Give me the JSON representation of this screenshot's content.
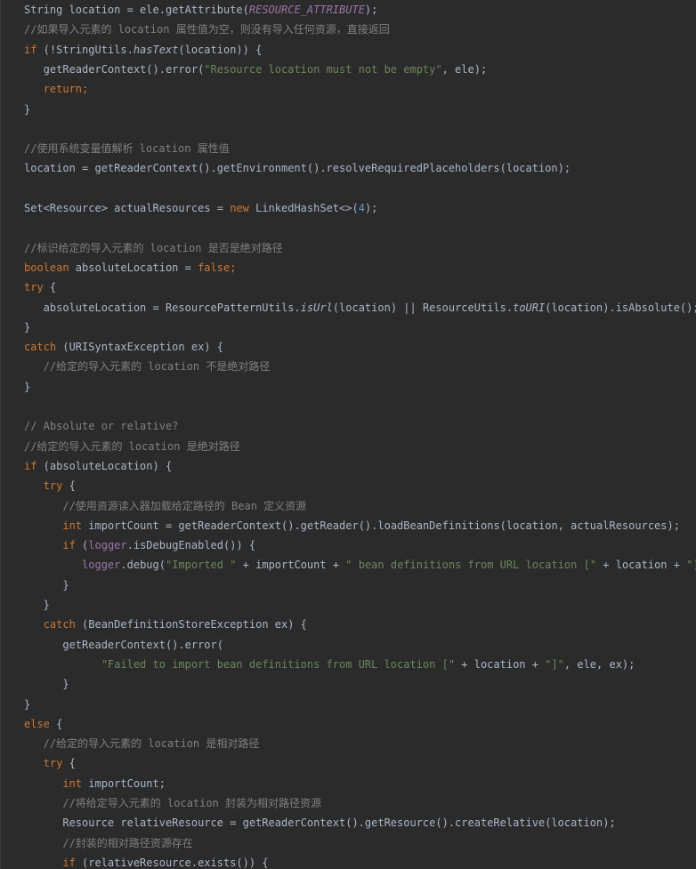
{
  "lines": [
    [
      {
        "t": "String location = ele.getAttribute(",
        "c": "pl"
      },
      {
        "t": "RESOURCE_ATTRIBUTE",
        "c": "cn"
      },
      {
        "t": ");",
        "c": "pl"
      }
    ],
    [
      {
        "t": "//如果导入元素的 location 属性值为空，则没有导入任何资源，直接返回",
        "c": "cm"
      }
    ],
    [
      {
        "t": "if",
        "c": "kw"
      },
      {
        "t": " (!StringUtils.",
        "c": "pl"
      },
      {
        "t": "hasText",
        "c": "it"
      },
      {
        "t": "(location)) {",
        "c": "pl"
      }
    ],
    [
      {
        "t": "   getReaderContext().error(",
        "c": "pl"
      },
      {
        "t": "\"Resource location must not be empty\"",
        "c": "str"
      },
      {
        "t": ", ele);",
        "c": "pl"
      }
    ],
    [
      {
        "t": "   ",
        "c": "pl"
      },
      {
        "t": "return",
        "c": "kw"
      },
      {
        "t": ";",
        "c": "kw"
      }
    ],
    [
      {
        "t": "}",
        "c": "pl"
      }
    ],
    [],
    [
      {
        "t": "//使用系统变量值解析 location 属性值",
        "c": "cm"
      }
    ],
    [
      {
        "t": "location = getReaderContext().getEnvironment().resolveRequiredPlaceholders(location);",
        "c": "pl"
      }
    ],
    [],
    [
      {
        "t": "Set<Resource> actualResources = ",
        "c": "pl"
      },
      {
        "t": "new",
        "c": "kw"
      },
      {
        "t": " LinkedHashSet<>(",
        "c": "pl"
      },
      {
        "t": "4",
        "c": "num"
      },
      {
        "t": ");",
        "c": "pl"
      }
    ],
    [],
    [
      {
        "t": "//标识给定的导入元素的 location 是否是绝对路径",
        "c": "cm"
      }
    ],
    [
      {
        "t": "boolean",
        "c": "kw"
      },
      {
        "t": " absoluteLocation = ",
        "c": "pl"
      },
      {
        "t": "false",
        "c": "kw"
      },
      {
        "t": ";",
        "c": "kw"
      }
    ],
    [
      {
        "t": "try",
        "c": "kw"
      },
      {
        "t": " {",
        "c": "pl"
      }
    ],
    [
      {
        "t": "   absoluteLocation = ResourcePatternUtils.",
        "c": "pl"
      },
      {
        "t": "isUrl",
        "c": "it"
      },
      {
        "t": "(location) || ResourceUtils.",
        "c": "pl"
      },
      {
        "t": "toURI",
        "c": "it"
      },
      {
        "t": "(location).isAbsolute();",
        "c": "pl"
      }
    ],
    [
      {
        "t": "}",
        "c": "pl"
      }
    ],
    [
      {
        "t": "catch",
        "c": "kw"
      },
      {
        "t": " (URISyntaxException ex) {",
        "c": "pl"
      }
    ],
    [
      {
        "t": "   //给定的导入元素的 location 不是绝对路径",
        "c": "cm"
      }
    ],
    [
      {
        "t": "}",
        "c": "pl"
      }
    ],
    [],
    [
      {
        "t": "// Absolute or relative?",
        "c": "cm"
      }
    ],
    [
      {
        "t": "//给定的导入元素的 location 是绝对路径",
        "c": "cm"
      }
    ],
    [
      {
        "t": "if",
        "c": "kw"
      },
      {
        "t": " (absoluteLocation) {",
        "c": "pl"
      }
    ],
    [
      {
        "t": "   ",
        "c": "pl"
      },
      {
        "t": "try",
        "c": "kw"
      },
      {
        "t": " {",
        "c": "pl"
      }
    ],
    [
      {
        "t": "      //使用资源读入器加载给定路径的 Bean 定义资源",
        "c": "cm"
      }
    ],
    [
      {
        "t": "      ",
        "c": "pl"
      },
      {
        "t": "int",
        "c": "kw"
      },
      {
        "t": " importCount = getReaderContext().getReader().loadBeanDefinitions(location, actualResources);",
        "c": "pl"
      }
    ],
    [
      {
        "t": "      ",
        "c": "pl"
      },
      {
        "t": "if",
        "c": "kw"
      },
      {
        "t": " (",
        "c": "pl"
      },
      {
        "t": "logger",
        "c": "fld"
      },
      {
        "t": ".isDebugEnabled()) {",
        "c": "pl"
      }
    ],
    [
      {
        "t": "         ",
        "c": "pl"
      },
      {
        "t": "logger",
        "c": "fld"
      },
      {
        "t": ".debug(",
        "c": "pl"
      },
      {
        "t": "\"Imported \"",
        "c": "str"
      },
      {
        "t": " + importCount + ",
        "c": "pl"
      },
      {
        "t": "\" bean definitions from URL location [\"",
        "c": "str"
      },
      {
        "t": " + location + ",
        "c": "pl"
      },
      {
        "t": "\"]\"",
        "c": "str"
      },
      {
        "t": ");",
        "c": "pl"
      }
    ],
    [
      {
        "t": "      }",
        "c": "pl"
      }
    ],
    [
      {
        "t": "   }",
        "c": "pl"
      }
    ],
    [
      {
        "t": "   ",
        "c": "pl"
      },
      {
        "t": "catch",
        "c": "kw"
      },
      {
        "t": " (BeanDefinitionStoreException ex) {",
        "c": "pl"
      }
    ],
    [
      {
        "t": "      getReaderContext().error(",
        "c": "pl"
      }
    ],
    [
      {
        "t": "            ",
        "c": "pl"
      },
      {
        "t": "\"Failed to import bean definitions from URL location [\"",
        "c": "str"
      },
      {
        "t": " + location + ",
        "c": "pl"
      },
      {
        "t": "\"]\"",
        "c": "str"
      },
      {
        "t": ", ele, ex);",
        "c": "pl"
      }
    ],
    [
      {
        "t": "      }",
        "c": "pl"
      }
    ],
    [
      {
        "t": "}",
        "c": "pl"
      }
    ],
    [
      {
        "t": "else",
        "c": "kw"
      },
      {
        "t": " {",
        "c": "pl"
      }
    ],
    [
      {
        "t": "   //给定的导入元素的 location 是相对路径",
        "c": "cm"
      }
    ],
    [
      {
        "t": "   ",
        "c": "pl"
      },
      {
        "t": "try",
        "c": "kw"
      },
      {
        "t": " {",
        "c": "pl"
      }
    ],
    [
      {
        "t": "      ",
        "c": "pl"
      },
      {
        "t": "int",
        "c": "kw"
      },
      {
        "t": " importCount;",
        "c": "pl"
      }
    ],
    [
      {
        "t": "      //将给定导入元素的 location 封装为相对路径资源",
        "c": "cm"
      }
    ],
    [
      {
        "t": "      Resource relativeResource = getReaderContext().getResource().createRelative(location);",
        "c": "pl"
      }
    ],
    [
      {
        "t": "      //封装的相对路径资源存在",
        "c": "cm"
      }
    ],
    [
      {
        "t": "      ",
        "c": "pl"
      },
      {
        "t": "if",
        "c": "kw"
      },
      {
        "t": " (relativeResource.exists()) {",
        "c": "pl"
      }
    ]
  ],
  "colors": {
    "background": "#2b2b2b",
    "plain": "#a9b7c6",
    "keyword": "#cc7832",
    "string": "#6a8759",
    "comment": "#808080",
    "constant": "#9876aa",
    "number": "#6897bb"
  }
}
